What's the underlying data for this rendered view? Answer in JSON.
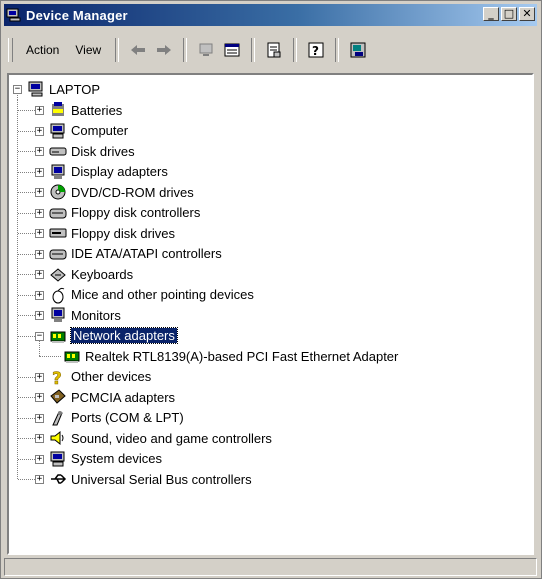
{
  "window": {
    "title": "Device Manager"
  },
  "title_buttons": {
    "minimize": "_",
    "maximize": "□",
    "close": "✕"
  },
  "menu": {
    "action": "Action",
    "view": "View"
  },
  "toolbar": {
    "icons": [
      "back-arrow-icon",
      "forward-arrow-icon",
      "computer-icon",
      "properties-list-icon",
      "properties-icon",
      "help-icon",
      "scan-hardware-icon"
    ]
  },
  "tree": {
    "root": "LAPTOP",
    "categories": [
      {
        "label": "Batteries",
        "icon": "battery-icon",
        "expanded": false
      },
      {
        "label": "Computer",
        "icon": "computer-icon",
        "expanded": false
      },
      {
        "label": "Disk drives",
        "icon": "disk-drive-icon",
        "expanded": false
      },
      {
        "label": "Display adapters",
        "icon": "monitor-icon",
        "expanded": false
      },
      {
        "label": "DVD/CD-ROM drives",
        "icon": "cd-drive-icon",
        "expanded": false
      },
      {
        "label": "Floppy disk controllers",
        "icon": "controller-icon",
        "expanded": false
      },
      {
        "label": "Floppy disk drives",
        "icon": "floppy-drive-icon",
        "expanded": false
      },
      {
        "label": "IDE ATA/ATAPI controllers",
        "icon": "controller-icon",
        "expanded": false
      },
      {
        "label": "Keyboards",
        "icon": "keyboard-icon",
        "expanded": false
      },
      {
        "label": "Mice and other pointing devices",
        "icon": "mouse-icon",
        "expanded": false
      },
      {
        "label": "Monitors",
        "icon": "monitor-icon",
        "expanded": false
      },
      {
        "label": "Network adapters",
        "icon": "network-card-icon",
        "expanded": true,
        "selected": true
      },
      {
        "label": "Other devices",
        "icon": "question-icon",
        "expanded": false
      },
      {
        "label": "PCMCIA adapters",
        "icon": "pcmcia-icon",
        "expanded": false
      },
      {
        "label": "Ports (COM & LPT)",
        "icon": "port-icon",
        "expanded": false
      },
      {
        "label": "Sound, video and game controllers",
        "icon": "speaker-icon",
        "expanded": false
      },
      {
        "label": "System devices",
        "icon": "computer-icon",
        "expanded": false
      },
      {
        "label": "Universal Serial Bus controllers",
        "icon": "usb-icon",
        "expanded": false
      }
    ],
    "network_child": "Realtek RTL8139(A)-based PCI Fast Ethernet Adapter"
  },
  "colors": {
    "selection": "#0a246a",
    "titlebar_start": "#0a246a",
    "titlebar_end": "#a6caf0",
    "face": "#d4d0c8"
  }
}
